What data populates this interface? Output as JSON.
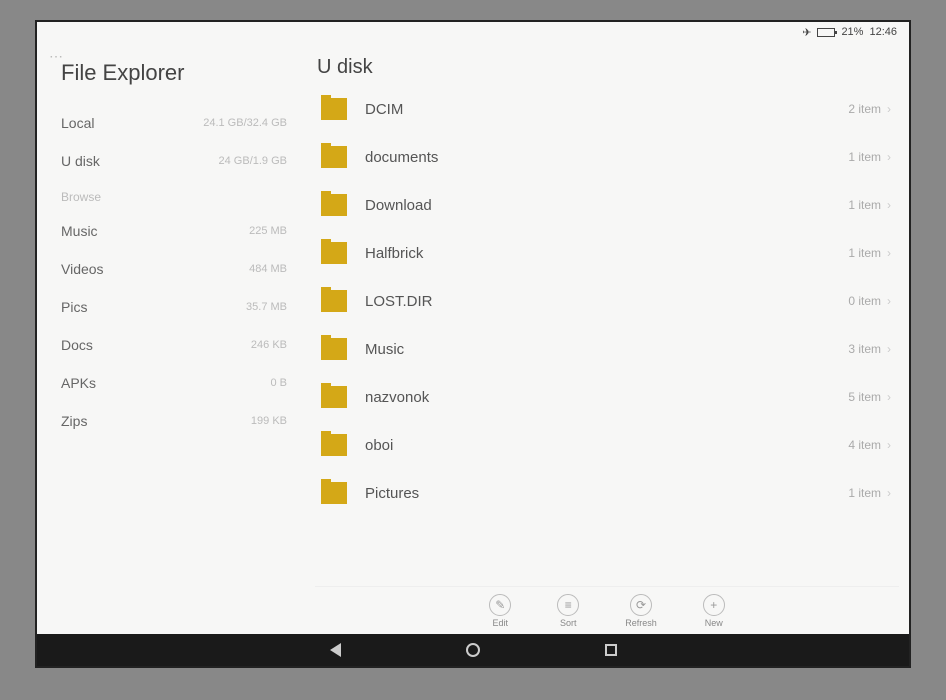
{
  "statusbar": {
    "battery_pct": "21%",
    "time": "12:46"
  },
  "sidebar": {
    "title": "File Explorer",
    "storage": [
      {
        "label": "Local",
        "meta": "24.1 GB/32.4 GB"
      },
      {
        "label": "U disk",
        "meta": "24 GB/1.9 GB"
      }
    ],
    "section_label": "Browse",
    "categories": [
      {
        "label": "Music",
        "meta": "225 MB"
      },
      {
        "label": "Videos",
        "meta": "484 MB"
      },
      {
        "label": "Pics",
        "meta": "35.7 MB"
      },
      {
        "label": "Docs",
        "meta": "246 KB"
      },
      {
        "label": "APKs",
        "meta": "0 B"
      },
      {
        "label": "Zips",
        "meta": "199 KB"
      }
    ]
  },
  "main": {
    "title": "U disk",
    "folders": [
      {
        "name": "DCIM",
        "count": "2 item"
      },
      {
        "name": "documents",
        "count": "1 item"
      },
      {
        "name": "Download",
        "count": "1 item"
      },
      {
        "name": "Halfbrick",
        "count": "1 item"
      },
      {
        "name": "LOST.DIR",
        "count": "0 item"
      },
      {
        "name": "Music",
        "count": "3 item"
      },
      {
        "name": "nazvonok",
        "count": "5 item"
      },
      {
        "name": "oboi",
        "count": "4 item"
      },
      {
        "name": "Pictures",
        "count": "1 item"
      }
    ]
  },
  "toolbar": {
    "edit": "Edit",
    "sort": "Sort",
    "refresh": "Refresh",
    "new": "New"
  }
}
